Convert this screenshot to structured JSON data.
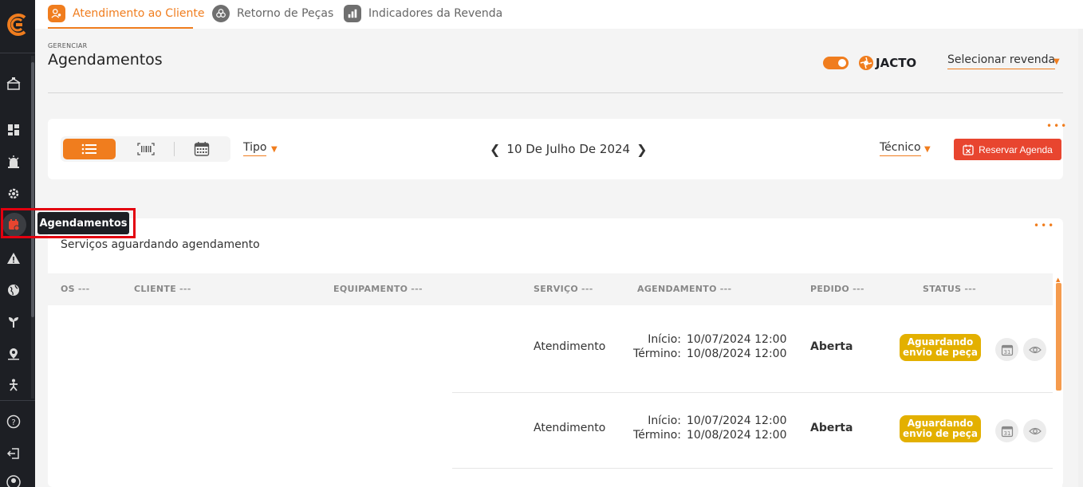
{
  "top_tabs": [
    {
      "label": "Atendimento ao Cliente",
      "active": true,
      "icon": "user-gear-icon"
    },
    {
      "label": "Retorno de Peças",
      "active": false,
      "icon": "parts-icon"
    },
    {
      "label": "Indicadores da Revenda",
      "active": false,
      "icon": "bar-chart-icon"
    }
  ],
  "header": {
    "breadcrumb": "GERENCIAR",
    "title": "Agendamentos",
    "brand": "JACTO",
    "select_revenda": "Selecionar revenda"
  },
  "sidebar": {
    "tooltip": "Agendamentos",
    "items": [
      "dealer-icon",
      "dashboard-icon",
      "alarm-icon",
      "gear-icon",
      "calendar-icon",
      "warning-icon",
      "globe-icon",
      "plant-icon",
      "location-icon",
      "person-icon",
      "help-icon",
      "logout-icon",
      "profile-icon"
    ]
  },
  "toolbar": {
    "tipo_label": "Tipo",
    "date": "10 De Julho De 2024",
    "tecnico_label": "Técnico",
    "reservar_label": "Reservar Agenda"
  },
  "table": {
    "title": "Serviços aguardando agendamento",
    "columns": [
      "OS",
      "CLIENTE",
      "EQUIPAMENTO",
      "SERVIÇO",
      "AGENDAMENTO",
      "PEDIDO",
      "STATUS"
    ],
    "more": "---",
    "rows": [
      {
        "servico": "Atendimento",
        "inicio_label": "Início:",
        "inicio": "10/07/2024 12:00",
        "termino_label": "Término:",
        "termino": "10/08/2024 12:00",
        "pedido": "Aberta",
        "status_l1": "Aguardando",
        "status_l2": "envio de peça"
      },
      {
        "servico": "Atendimento",
        "inicio_label": "Início:",
        "inicio": "10/07/2024 12:00",
        "termino_label": "Término:",
        "termino": "10/08/2024 12:00",
        "pedido": "Aberta",
        "status_l1": "Aguardando",
        "status_l2": "envio de peça"
      }
    ]
  },
  "colors": {
    "accent": "#f07d1e",
    "danger": "#e8452f",
    "status": "#e3b000",
    "sidebar": "#1d1f24"
  }
}
